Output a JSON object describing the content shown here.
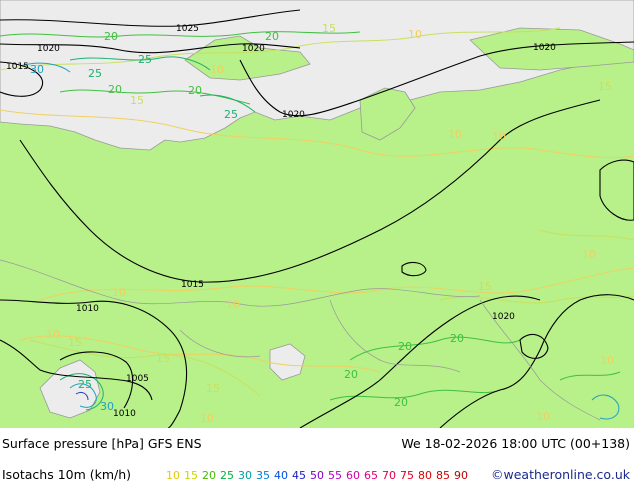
{
  "map": {
    "contour_labels": {
      "isobars": [
        "1025",
        "1020",
        "1020",
        "1015",
        "1020",
        "1020",
        "1015",
        "1010",
        "1005",
        "1010",
        "1020"
      ],
      "isotachs": [
        "15",
        "20",
        "25",
        "30",
        "25",
        "20",
        "20",
        "25",
        "20",
        "15",
        "10",
        "10",
        "10",
        "15",
        "10",
        "10",
        "15",
        "10",
        "15",
        "15",
        "20",
        "20",
        "25",
        "30",
        "20",
        "15",
        "20",
        "10",
        "10",
        "10",
        "10",
        "10"
      ]
    },
    "colors": {
      "land": "#b8f08a",
      "sea": "#ececec",
      "isobar": "#000000",
      "coast": "#999999",
      "isotach_10": "#f0d060",
      "isotach_15": "#c8e060",
      "isotach_20": "#40c040",
      "isotach_25": "#20b070",
      "isotach_30": "#20a0c0",
      "isotach_35": "#2080e0",
      "isotach_40": "#2040c0"
    }
  },
  "footer": {
    "title": "Surface pressure [hPa] GFS ENS",
    "datetime": "We 18-02-2026 18:00 UTC (00+138)",
    "legend_title": "Isotachs 10m (km/h)",
    "credit": "©weatheronline.co.uk",
    "scale": [
      {
        "value": "10",
        "color": "#e8c800"
      },
      {
        "value": "15",
        "color": "#c8d800"
      },
      {
        "value": "20",
        "color": "#40c000"
      },
      {
        "value": "25",
        "color": "#00b040"
      },
      {
        "value": "30",
        "color": "#00a0a0"
      },
      {
        "value": "35",
        "color": "#0080d0"
      },
      {
        "value": "40",
        "color": "#0050e0"
      },
      {
        "value": "45",
        "color": "#2020c0"
      },
      {
        "value": "50",
        "color": "#8000c0"
      },
      {
        "value": "55",
        "color": "#b000c0"
      },
      {
        "value": "60",
        "color": "#d000a0"
      },
      {
        "value": "65",
        "color": "#e00080"
      },
      {
        "value": "70",
        "color": "#e00050"
      },
      {
        "value": "75",
        "color": "#e00020"
      },
      {
        "value": "80",
        "color": "#e00000"
      },
      {
        "value": "85",
        "color": "#d00000"
      },
      {
        "value": "90",
        "color": "#c00000"
      }
    ]
  }
}
